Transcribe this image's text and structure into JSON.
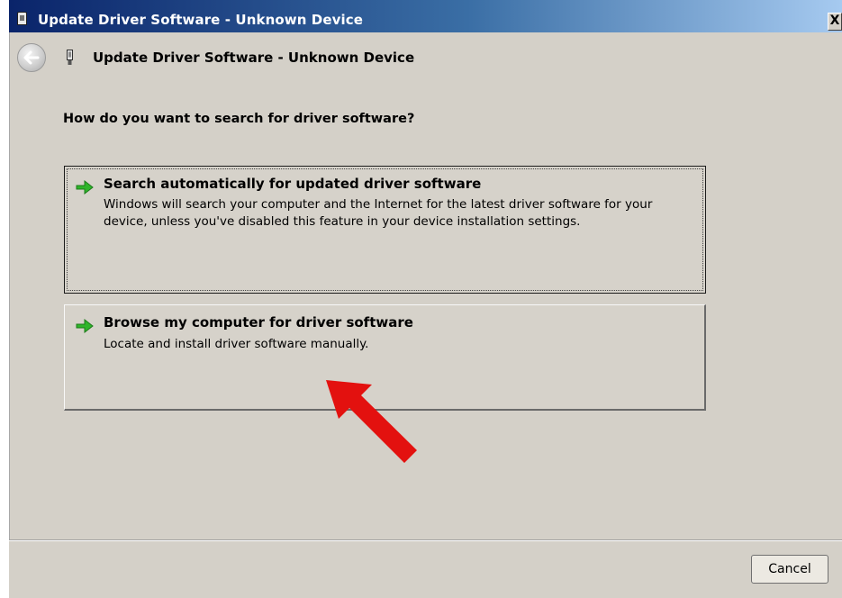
{
  "window": {
    "title": "Update Driver Software - Unknown Device",
    "close_glyph": "X"
  },
  "header": {
    "title": "Update Driver Software - Unknown Device"
  },
  "main": {
    "question": "How do you want to search for driver software?",
    "options": [
      {
        "title": "Search automatically for updated driver software",
        "description": "Windows will search your computer and the Internet for the latest driver software for your device, unless you've disabled this feature in your device installation settings.",
        "icon": "green-arrow-icon"
      },
      {
        "title": "Browse my computer for driver software",
        "description": "Locate and install driver software manually.",
        "icon": "green-arrow-icon"
      }
    ],
    "annotation": {
      "icon": "red-pointer-arrow",
      "color": "#e3110f"
    }
  },
  "footer": {
    "cancel_label": "Cancel"
  },
  "colors": {
    "titlebar_start": "#0a246a",
    "dialog_background": "#d4d0c8",
    "option_arrow": "#2fb52a"
  }
}
